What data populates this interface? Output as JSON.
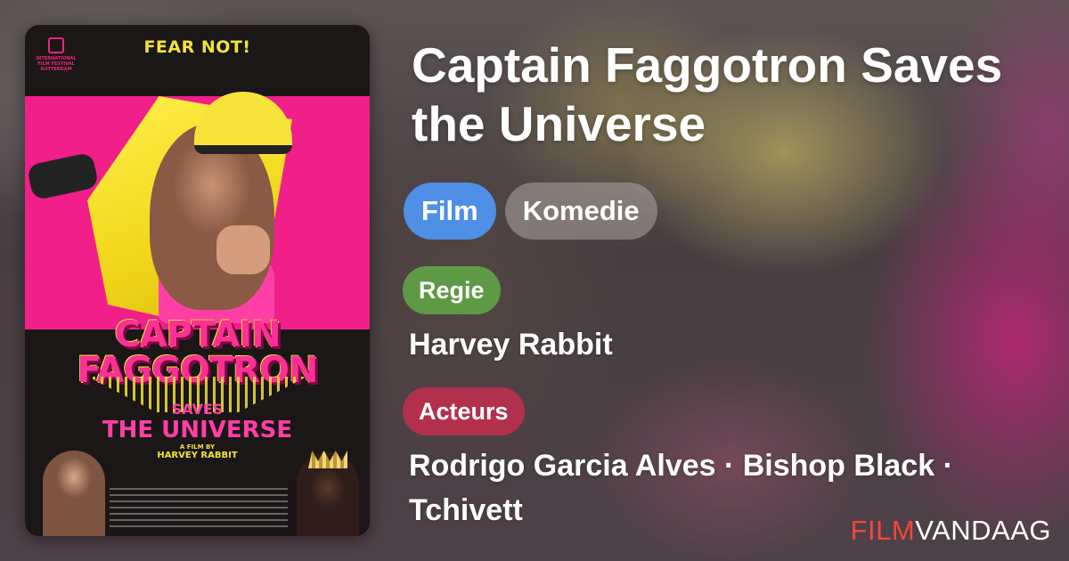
{
  "poster": {
    "festival_logo": "INTERNATIONAL FILM FESTIVAL ROTTERDAM",
    "tagline": "FEAR NOT!",
    "title_line1": "CAPTAIN",
    "title_line2": "FAGGOTRON",
    "title_line3": "SAVES",
    "title_line4": "THE UNIVERSE",
    "afilmby": "A FILM BY",
    "director": "HARVEY RABBIT"
  },
  "movie": {
    "title": "Captain Faggotron Saves the Universe",
    "tags": [
      "Film",
      "Komedie"
    ]
  },
  "credits": {
    "regie_label": "Regie",
    "regie_value": "Harvey Rabbit",
    "acteurs_label": "Acteurs",
    "acteurs_value": "Rodrigo Garcia Alves · Bishop Black · Tchivett"
  },
  "brand": {
    "part1": "FILM",
    "part2": "VANDAAG"
  },
  "colors": {
    "tag_primary": "#4f8fe6",
    "regie": "#5e9a45",
    "acteurs": "#b2304c",
    "brand_accent": "#f2473c"
  }
}
